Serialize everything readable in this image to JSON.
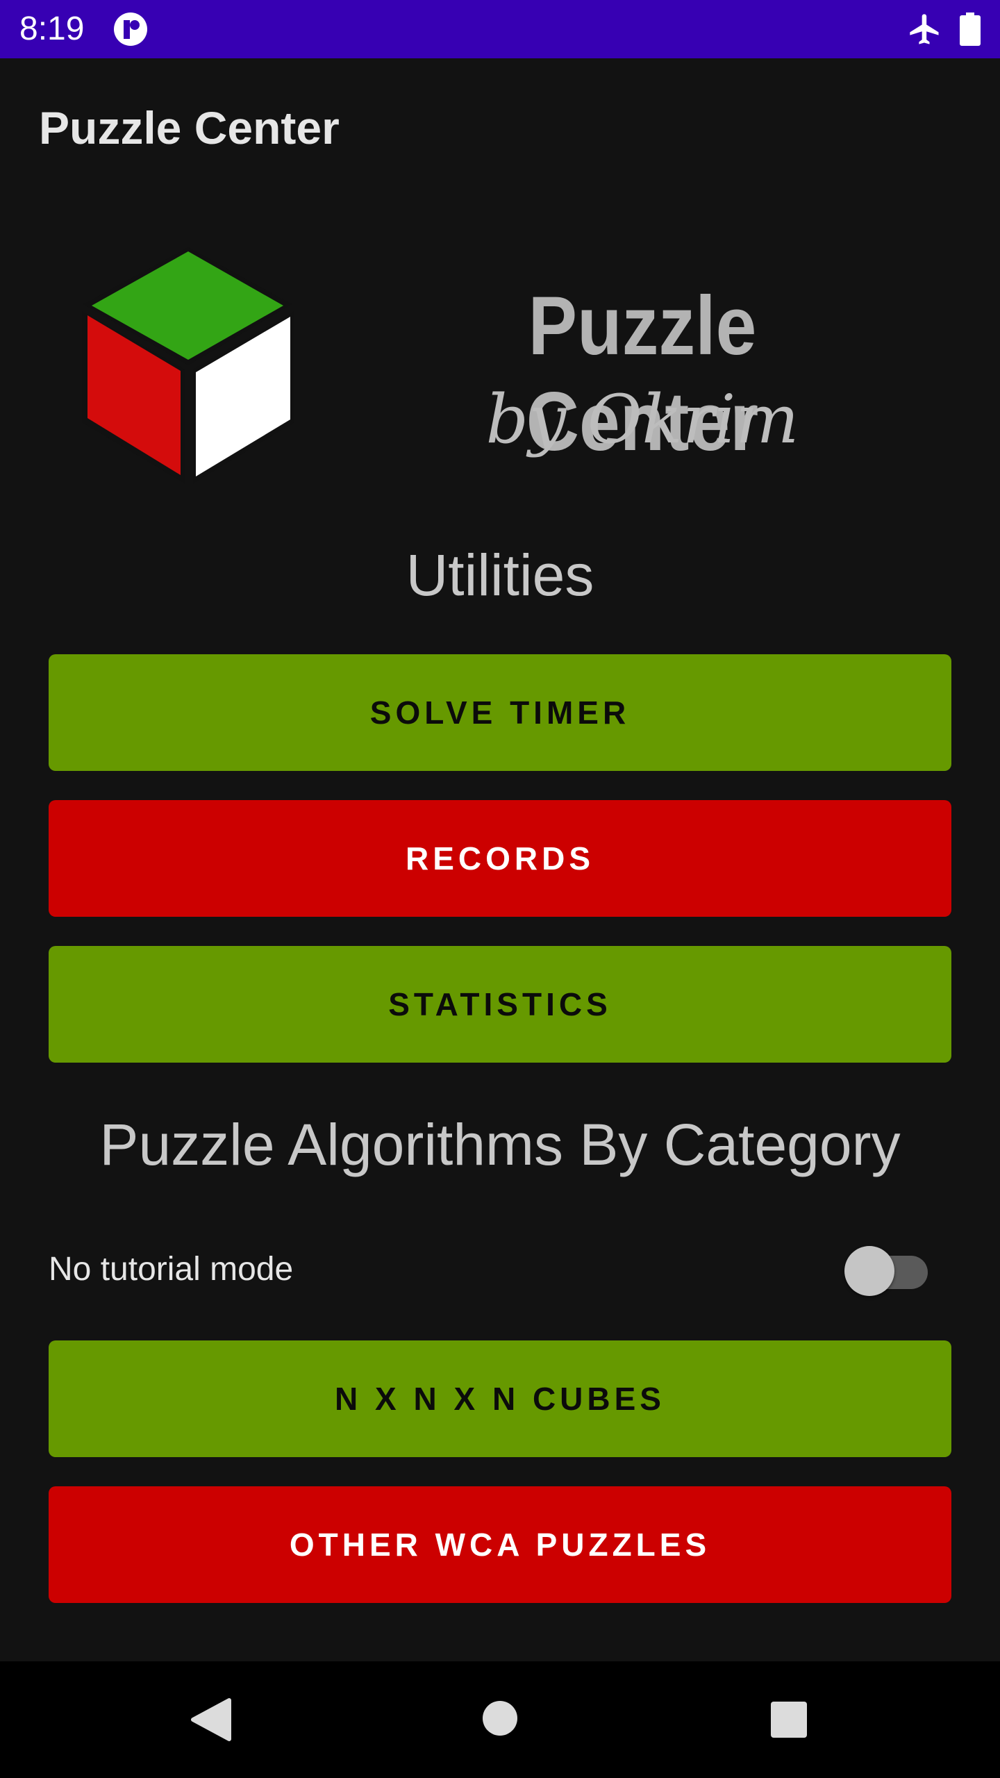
{
  "status_bar": {
    "time": "8:19",
    "color": "#3700b3",
    "icons": [
      "app-notification-icon",
      "airplane-mode-icon",
      "battery-icon"
    ]
  },
  "app_bar": {
    "title": "Puzzle Center"
  },
  "logo": {
    "title": "Puzzle Center",
    "subtitle": "by Okrim",
    "cube_colors": [
      "#33a515",
      "#d40c0c",
      "#ffffff"
    ]
  },
  "utilities": {
    "heading": "Utilities",
    "buttons": [
      {
        "label": "SOLVE TIMER",
        "color": "#669900"
      },
      {
        "label": "RECORDS",
        "color": "#cc0000"
      },
      {
        "label": "STATISTICS",
        "color": "#669900"
      }
    ]
  },
  "algorithms": {
    "heading": "Puzzle Algorithms By Category",
    "tutorial_toggle": {
      "label": "No tutorial mode",
      "checked": false
    },
    "buttons": [
      {
        "label": "N X N X N CUBES",
        "color": "#669900"
      },
      {
        "label": "OTHER WCA PUZZLES",
        "color": "#cc0000"
      }
    ]
  },
  "nav_bar": {
    "icons": [
      "back-icon",
      "home-icon",
      "recents-icon"
    ]
  }
}
